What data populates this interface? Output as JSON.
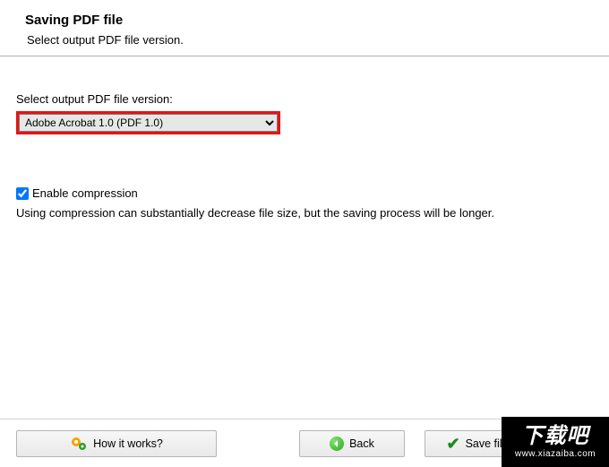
{
  "header": {
    "title": "Saving PDF file",
    "subtitle": "Select output PDF file version."
  },
  "version": {
    "label": "Select output PDF file version:",
    "selected": "Adobe Acrobat 1.0 (PDF 1.0)"
  },
  "compression": {
    "checkbox_label": "Enable compression",
    "checked": true,
    "description": "Using compression can substantially decrease file size, but the saving process will be longer."
  },
  "footer": {
    "how_label": "How it works?",
    "back_label": "Back",
    "save_label": "Save file"
  },
  "watermark": {
    "big": "下载吧",
    "small": "www.xiazaiba.com"
  }
}
